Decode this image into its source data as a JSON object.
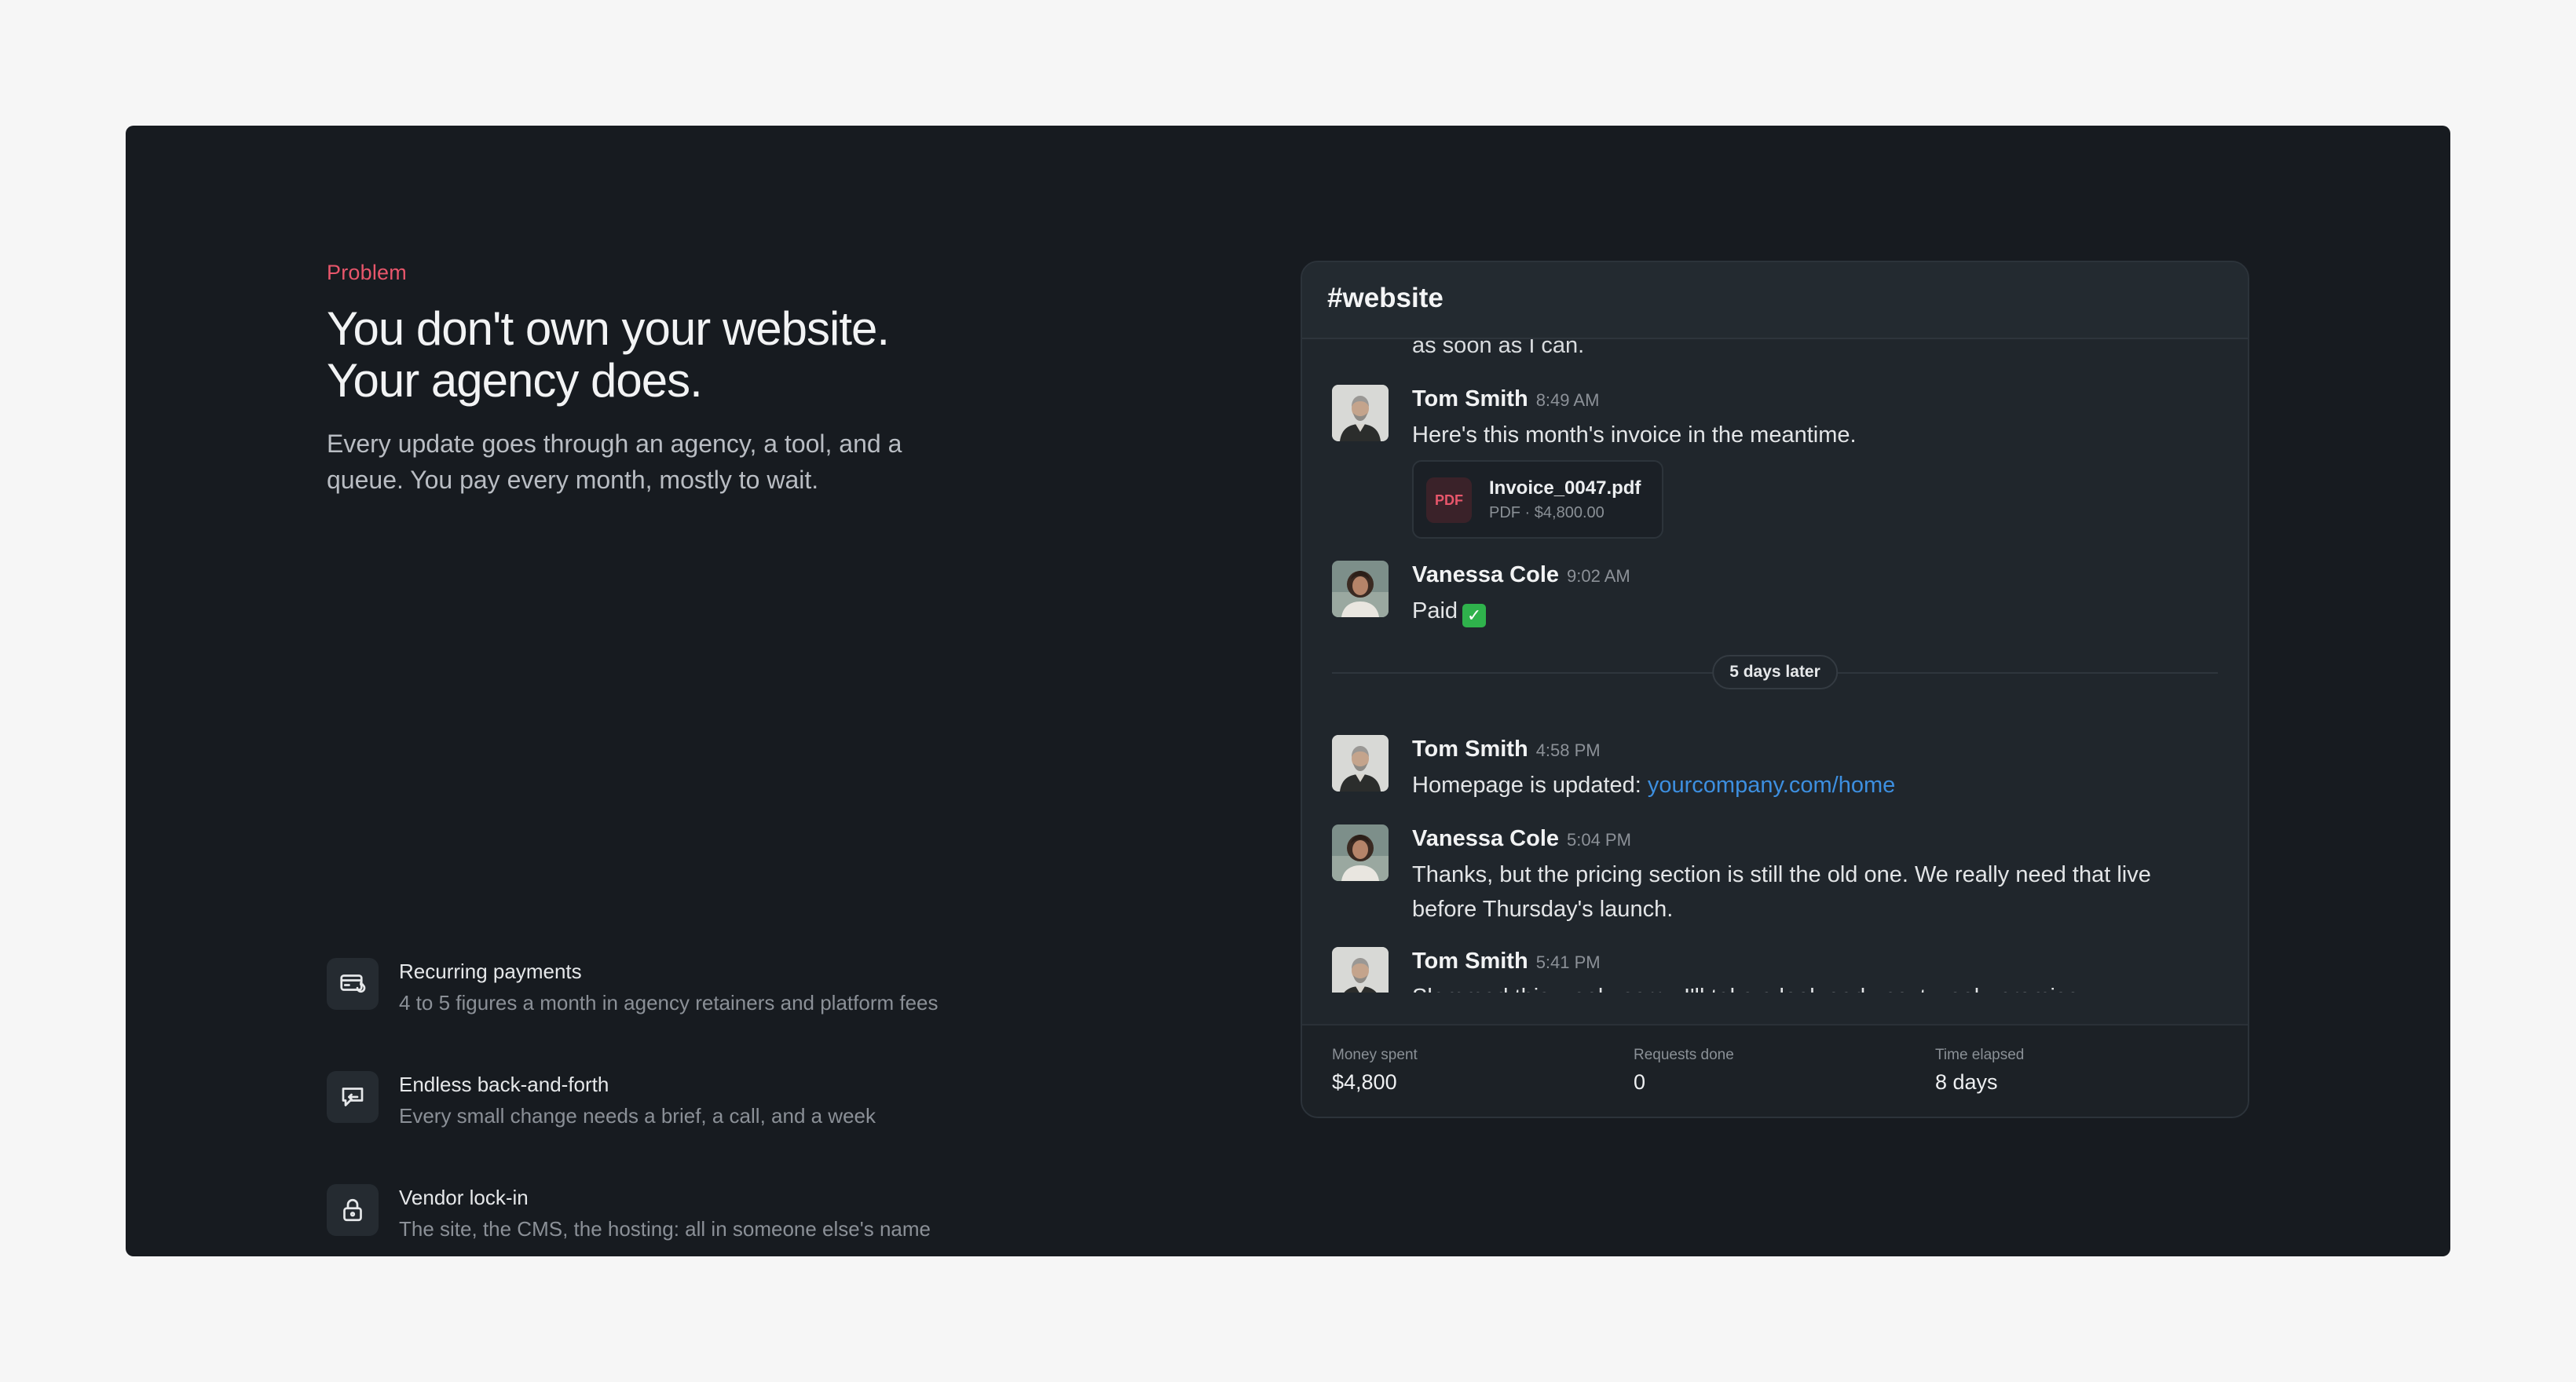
{
  "left": {
    "eyebrow": "Problem",
    "headline_line1": "You don't own your website.",
    "headline_line2": "Your agency does.",
    "subtitle": "Every update goes through an agency, a tool, and a queue. You pay every month, mostly to wait.",
    "features": [
      {
        "title": "Recurring payments",
        "desc": "4 to 5 figures a month in agency retainers and platform fees",
        "icon": "credit-card-icon"
      },
      {
        "title": "Endless back-and-forth",
        "desc": "Every small change needs a brief, a call, and a week",
        "icon": "chat-loop-icon"
      },
      {
        "title": "Vendor lock-in",
        "desc": "The site, the CMS, the hosting: all in someone else's name",
        "icon": "lock-icon"
      }
    ]
  },
  "chat": {
    "channel": "#website",
    "clipped_text": "as soon as I can.",
    "messages": [
      {
        "name": "Tom Smith",
        "time": "8:49 AM",
        "text": "Here's this month's invoice in the meantime."
      },
      {
        "name": "Vanessa Cole",
        "time": "9:02 AM",
        "text": "Paid"
      },
      {
        "name": "Tom Smith",
        "time": "4:58 PM",
        "text": "Homepage is updated: ",
        "link": "yourcompany.com/home"
      },
      {
        "name": "Vanessa Cole",
        "time": "5:04 PM",
        "text": "Thanks, but the pricing section is still the old one. We really need that live before Thursday's launch."
      },
      {
        "name": "Tom Smith",
        "time": "5:41 PM",
        "text": "Slammed this week, sorry. I'll take a look early next week, promise."
      }
    ],
    "attachment": {
      "badge": "PDF",
      "name": "Invoice_0047.pdf",
      "meta": "PDF · $4,800.00"
    },
    "divider": "5 days later",
    "stats": [
      {
        "label": "Money spent",
        "value": "$4,800"
      },
      {
        "label": "Requests done",
        "value": "0"
      },
      {
        "label": "Time elapsed",
        "value": "8 days"
      }
    ]
  },
  "colors": {
    "accent": "#e8566b",
    "link": "#3d8fe0",
    "panel_bg": "#171b20",
    "card_bg": "#20262c",
    "check": "#2fb24c"
  }
}
